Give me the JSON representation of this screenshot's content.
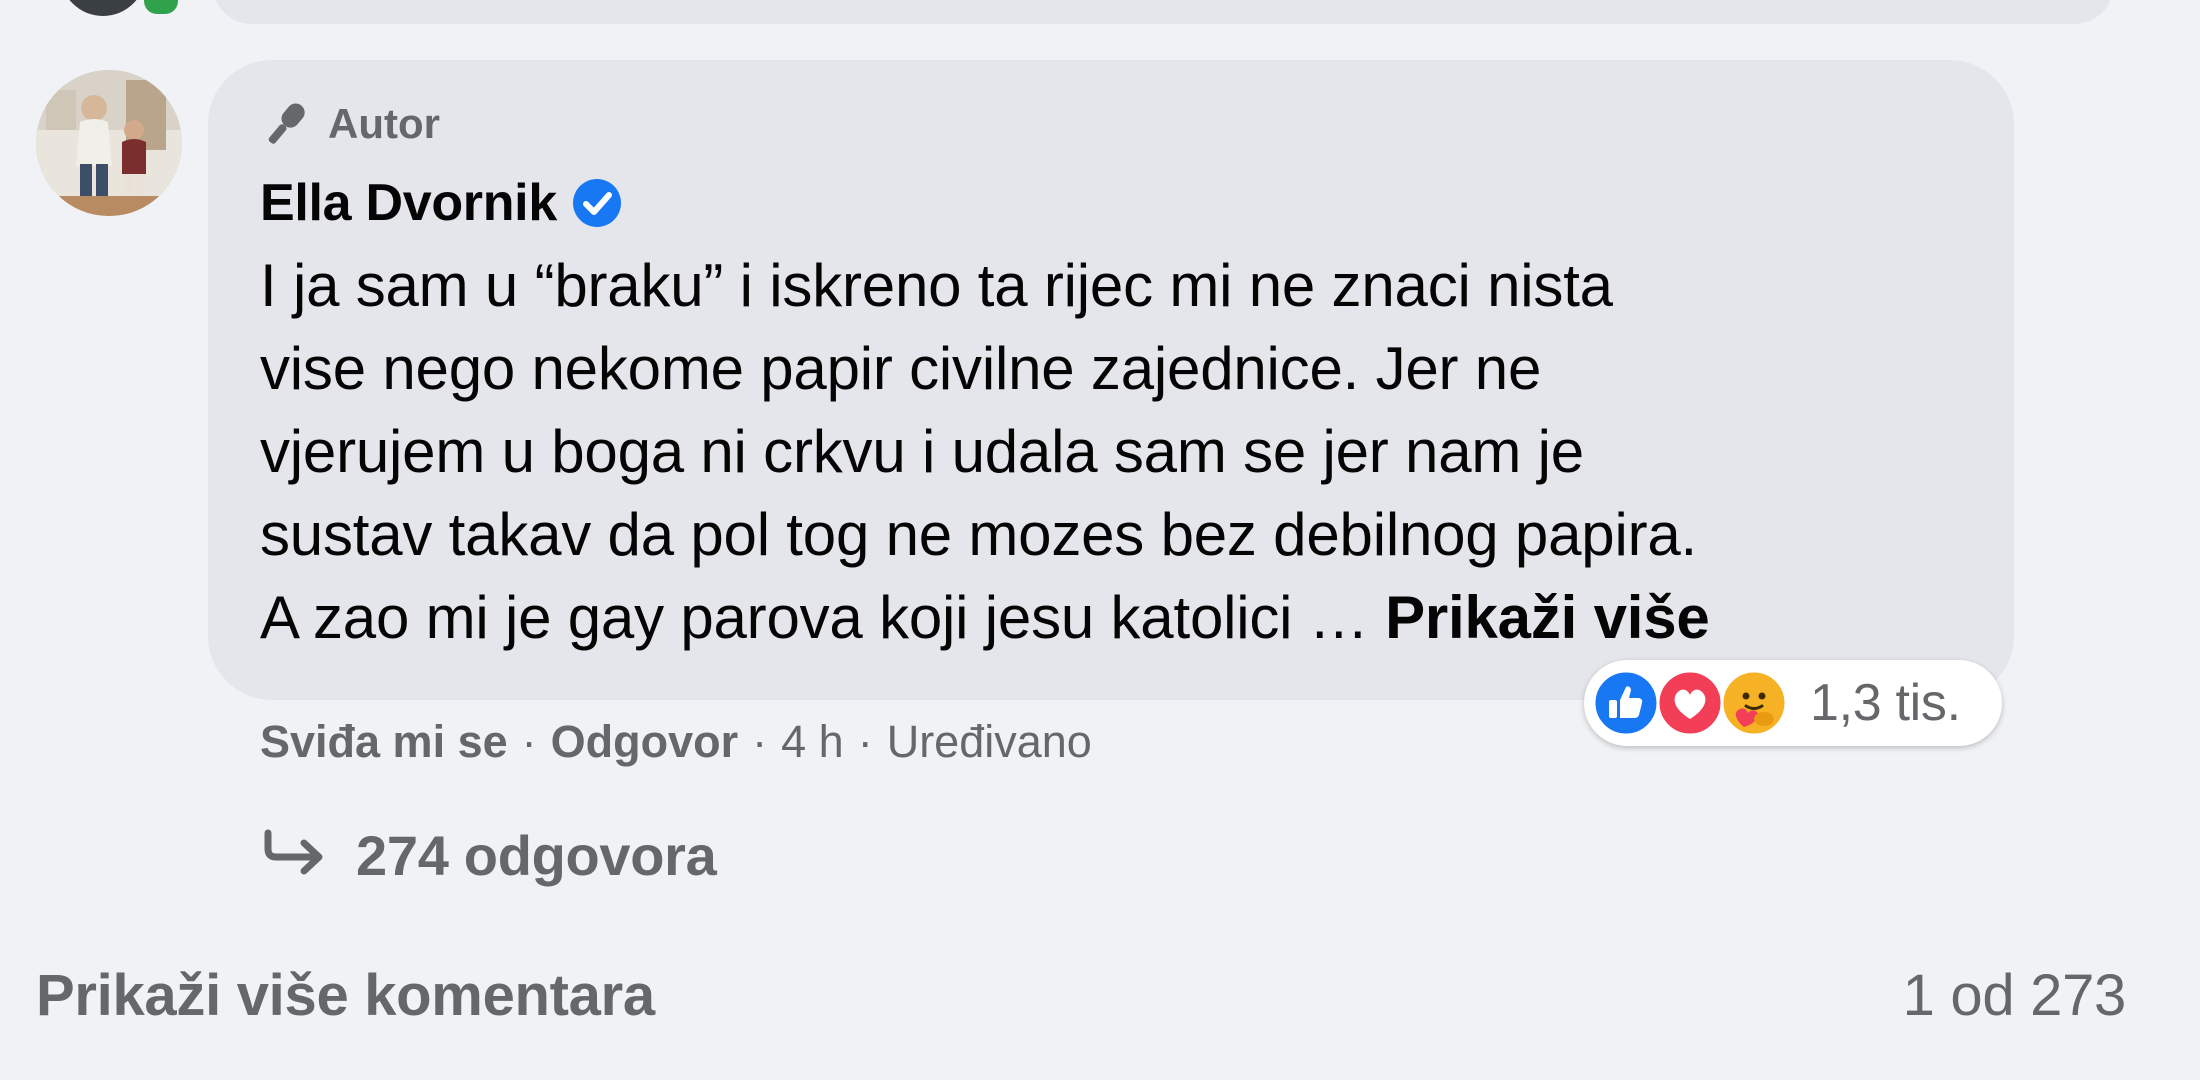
{
  "comment": {
    "badge": "Autor",
    "author_name": "Ella Dvornik",
    "text_lines": [
      "I ja sam u “braku” i iskreno ta rijec mi ne znaci nista",
      "vise nego nekome papir civilne zajednice. Jer ne",
      "vjerujem u boga ni crkvu i udala sam se jer nam je",
      "sustav takav da pol tog ne mozes bez debilnog papira.",
      "A zao mi je gay parova koji jesu katolici … "
    ],
    "see_more": "Prikaži više",
    "reactions": {
      "icons": [
        "like-icon",
        "love-icon",
        "care-icon"
      ],
      "count": "1,3 tis."
    },
    "actions": {
      "like": "Sviđa mi se",
      "reply": "Odgovor",
      "time": "4 h",
      "edited": "Uređivano",
      "separator": "·"
    },
    "replies": "274 odgovora"
  },
  "footer": {
    "more_comments": "Prikaži više komentara",
    "count": "1 od 273"
  },
  "colors": {
    "background": "#f0f2f5",
    "bubble": "#e4e6eb",
    "secondary_text": "#65676b",
    "verified_blue": "#1877f2",
    "like_blue": "#1877f2",
    "love_red": "#f33e58",
    "care_yellow": "#f7b125"
  }
}
